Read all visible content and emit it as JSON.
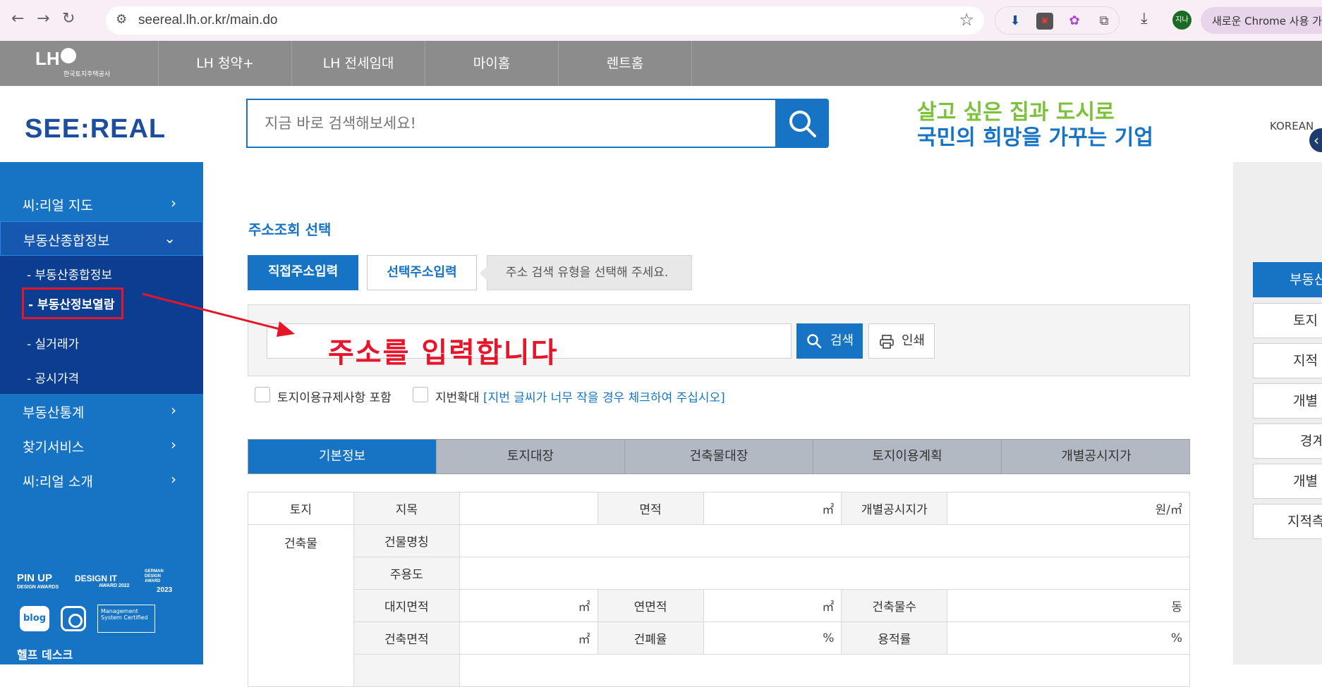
{
  "browser": {
    "url": "seereal.lh.or.kr/main.do",
    "profile_label": "지나",
    "new_chrome_label": "새로운 Chrome 사용 가능"
  },
  "lh_bar": {
    "logo_mark": "LH",
    "logo_sub": "한국토지주택공사",
    "tabs": [
      "LH 청약+",
      "LH 전세임대",
      "마이홈",
      "렌트홈"
    ]
  },
  "header": {
    "brand": "SEE:REAL",
    "search_placeholder": "지금 바로 검색해보세요!",
    "slogan_line1": "살고 싶은 집과 도시로",
    "slogan_line2": "국민의 희망을 가꾸는 기업",
    "language": "KOREAN"
  },
  "sidebar": {
    "items": [
      {
        "label": "씨:리얼 지도",
        "chevron": "›"
      },
      {
        "label": "부동산종합정보",
        "chevron": "⌄"
      },
      {
        "label": "부동산통계",
        "chevron": "›"
      },
      {
        "label": "찾기서비스",
        "chevron": "›"
      },
      {
        "label": "씨:리얼 소개",
        "chevron": "›"
      }
    ],
    "subitems": [
      "- 부동산종합정보",
      "- 부동산정보열람",
      "- 실거래가",
      "- 공시가격"
    ],
    "awards": {
      "pinup": "PIN UP",
      "pinup_sub": "DESIGN AWARDS",
      "designit": "DESIGN IT",
      "designit_sub": "AWARD 2022",
      "german": "GERMAN DESIGN AWARD",
      "german_year": "2023",
      "blog": "blog",
      "cert": "Management System Certified"
    },
    "helpdesk": "헬프 데스크"
  },
  "main": {
    "section_title": "주소조회 선택",
    "mode_direct": "직접주소입력",
    "mode_select": "선택주소입력",
    "mode_hint": "주소 검색 유형을 선택해 주세요.",
    "annotation": "주소를 입력합니다",
    "search_button": "검색",
    "print_button": "인쇄",
    "option1": "토지이용규제사항 포함",
    "option2": "지번확대",
    "option2_note": "[지번 글씨가 너무 작을 경우 체크하여 주십시오]",
    "tabs": [
      "기본정보",
      "토지대장",
      "건축물대장",
      "토지이용계획",
      "개별공시지가"
    ],
    "table": {
      "land": "토지",
      "jimok": "지목",
      "area": "면적",
      "unit_m2": "㎡",
      "price": "개별공시지가",
      "unit_won": "원/㎡",
      "building": "건축물",
      "bld_name": "건물명칭",
      "use": "주용도",
      "site_area": "대지면적",
      "total_area": "연면적",
      "bld_count": "건축물수",
      "unit_dong": "동",
      "bld_area": "건축면적",
      "bcr": "건폐율",
      "far": "용적률",
      "unit_pct": "%"
    }
  },
  "right_panel": {
    "head": "부동산",
    "items": [
      "토지",
      "지적",
      "개별",
      "경계",
      "개별",
      "지적측"
    ]
  },
  "colors": {
    "primary": "#1774c4",
    "sidebar_dark": "#0b3d91",
    "annotation_red": "#e8142a",
    "lh_gray": "#8c8c8c"
  }
}
